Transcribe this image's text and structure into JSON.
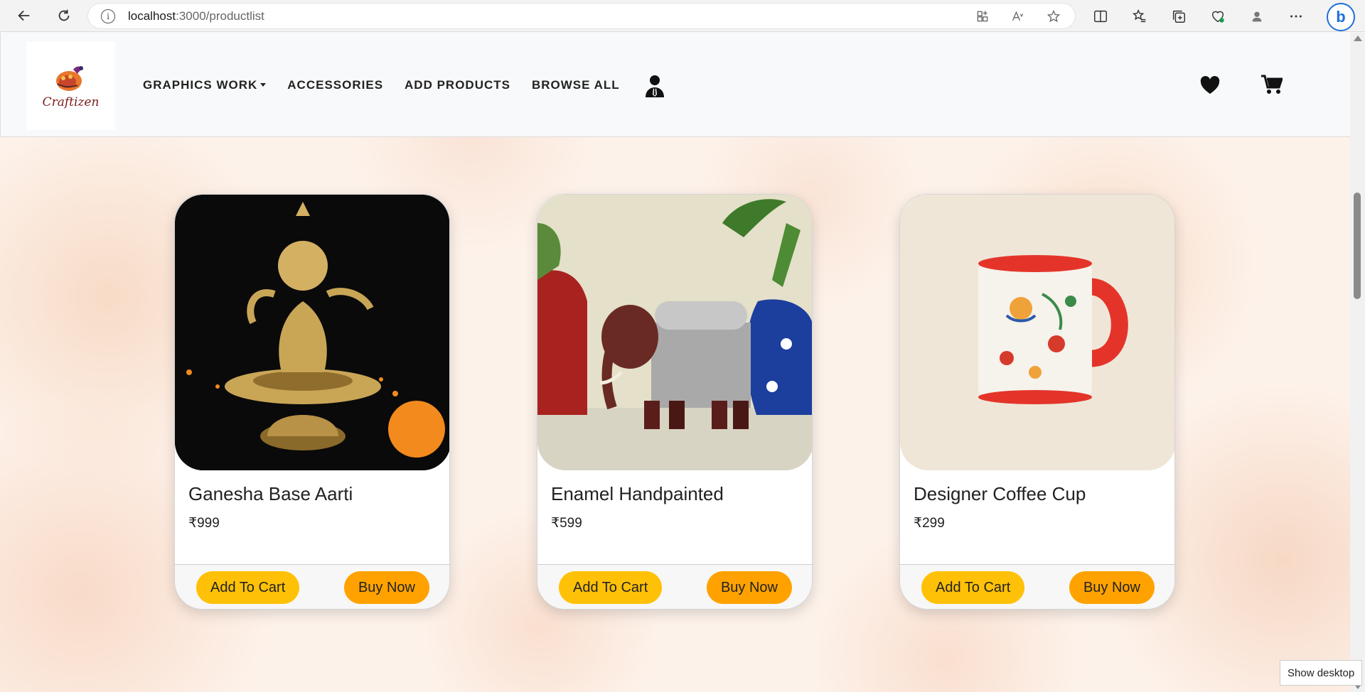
{
  "browser": {
    "url_host": "localhost",
    "url_path": ":3000/productlist"
  },
  "navbar": {
    "logo_text": "Craftizen",
    "links": [
      {
        "label": "GRAPHICS WORK",
        "dropdown": true
      },
      {
        "label": "ACCESSORIES"
      },
      {
        "label": "ADD PRODUCTS"
      },
      {
        "label": "BROWSE ALL"
      }
    ]
  },
  "products": [
    {
      "title": "Ganesha Base Aarti",
      "price": "₹999",
      "add_label": "Add To Cart",
      "buy_label": "Buy Now",
      "image": "brass-ganesha-diya"
    },
    {
      "title": "Enamel Handpainted",
      "price": "₹599",
      "add_label": "Add To Cart",
      "buy_label": "Buy Now",
      "image": "enamel-elephant"
    },
    {
      "title": "Designer Coffee Cup",
      "price": "₹299",
      "add_label": "Add To Cart",
      "buy_label": "Buy Now",
      "image": "painted-coffee-mug"
    }
  ],
  "taskbar": {
    "tooltip": "Show desktop"
  },
  "colors": {
    "add_to_cart": "#ffc107",
    "buy_now": "#ffa200",
    "page_background": "#fdf2ea"
  }
}
